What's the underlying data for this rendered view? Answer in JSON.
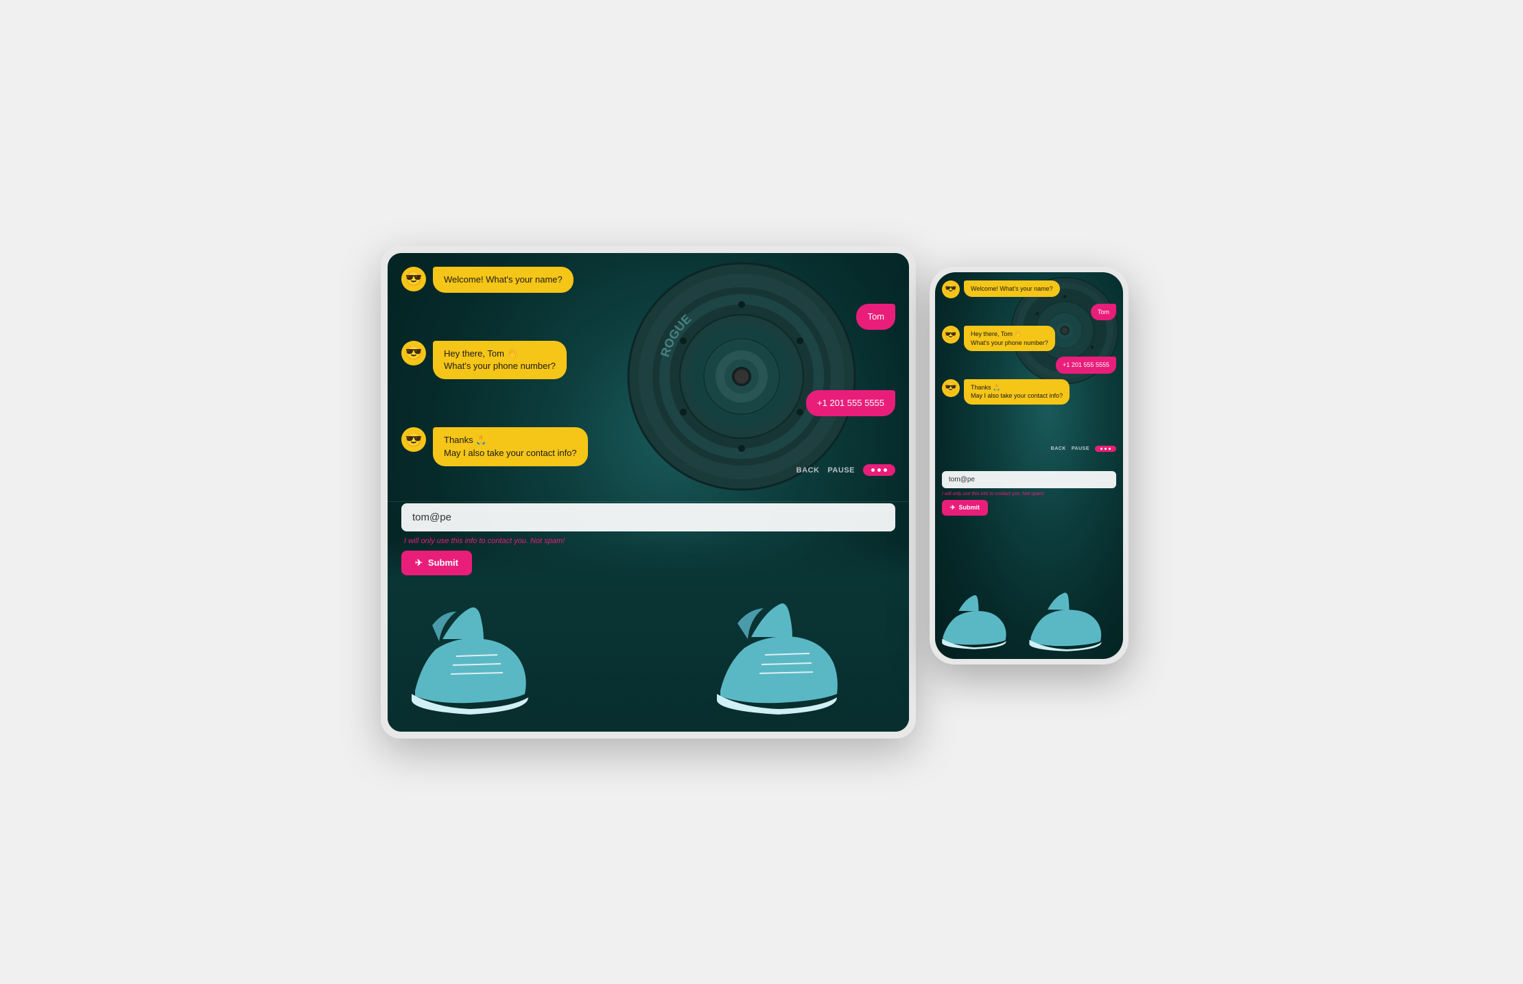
{
  "tablet": {
    "chat": {
      "msg1": {
        "avatar": "😎",
        "text": "Welcome! What's your name?"
      },
      "msg2_user": "Tom",
      "msg3": {
        "avatar": "😎",
        "text": "Hey there, Tom 👋\nWhat's your phone number?"
      },
      "msg4_user": "+1 201 555 5555",
      "msg5": {
        "avatar": "😎",
        "text": "Thanks 🙏\nMay I also take your contact info?"
      }
    },
    "input": {
      "value": "tom@pe",
      "placeholder": "tom@pe",
      "spam_notice": "I will only use this info to contact you. Not spam!",
      "submit_label": "Submit"
    },
    "controls": {
      "back": "BACK",
      "pause": "PAUSE"
    }
  },
  "phone": {
    "chat": {
      "msg1": {
        "avatar": "😎",
        "text": "Welcome! What's your name?"
      },
      "msg2_user": "Tom",
      "msg3": {
        "avatar": "😎",
        "text": "Hey there, Tom 👋\nWhat's your phone number?"
      },
      "msg4_user": "+1 201 555 5555",
      "msg5": {
        "avatar": "😎",
        "text": "Thanks 🙏\nMay I also take your contact info?"
      }
    },
    "input": {
      "value": "tom@pe",
      "spam_notice": "I will only use this info to contact you. Not spam!",
      "submit_label": "Submit"
    },
    "controls": {
      "back": "BACK",
      "pause": "PAUSE"
    }
  },
  "colors": {
    "accent": "#e91e7a",
    "bot_bubble": "#f5c518",
    "user_bubble": "#e91e7a"
  }
}
